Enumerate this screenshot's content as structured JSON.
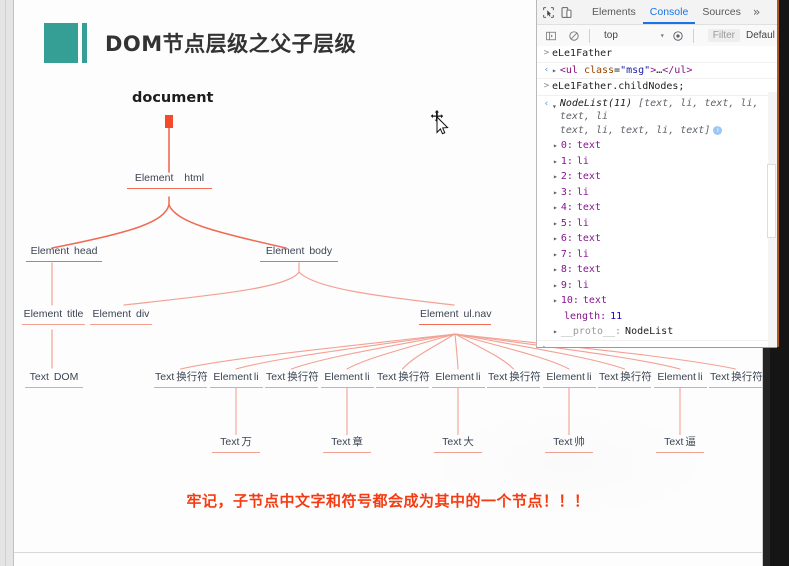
{
  "slide": {
    "title": "DOM节点层级之父子层级",
    "root_label": "document",
    "warning": "牢记，子节点中文字和符号都会成为其中的一个节点！！！",
    "accent_color": "#359e95",
    "line_color": "#f06a54",
    "warning_color": "#f63b12",
    "nodes": [
      {
        "id": "html",
        "kind": "Element",
        "name": "html"
      },
      {
        "id": "head",
        "kind": "Element",
        "name": "head"
      },
      {
        "id": "body",
        "kind": "Element",
        "name": "body"
      },
      {
        "id": "title",
        "kind": "Element",
        "name": "title"
      },
      {
        "id": "div",
        "kind": "Element",
        "name": "div"
      },
      {
        "id": "ulnav",
        "kind": "Element",
        "name": "ul.nav"
      },
      {
        "id": "dom",
        "kind": "Text",
        "name": "DOM"
      }
    ],
    "leaf_nodes": [
      {
        "kind": "Text",
        "name": "换行符"
      },
      {
        "kind": "Element",
        "name": "li"
      },
      {
        "kind": "Text",
        "name": "换行符"
      },
      {
        "kind": "Element",
        "name": "li"
      },
      {
        "kind": "Text",
        "name": "换行符"
      },
      {
        "kind": "Element",
        "name": "li"
      },
      {
        "kind": "Text",
        "name": "换行符"
      },
      {
        "kind": "Element",
        "name": "li"
      },
      {
        "kind": "Text",
        "name": "换行符"
      },
      {
        "kind": "Element",
        "name": "li"
      },
      {
        "kind": "Text",
        "name": "换行符"
      }
    ],
    "text_children": [
      {
        "kind": "Text",
        "name": "万"
      },
      {
        "kind": "Text",
        "name": "章"
      },
      {
        "kind": "Text",
        "name": "大"
      },
      {
        "kind": "Text",
        "name": "帅"
      },
      {
        "kind": "Text",
        "name": "逼"
      }
    ]
  },
  "devtools": {
    "tabs": [
      {
        "label": "Elements",
        "active": false
      },
      {
        "label": "Console",
        "active": true
      },
      {
        "label": "Sources",
        "active": false
      }
    ],
    "more_tabs": "»",
    "kebab": "⋮",
    "inspect_icon": "inspect-element-icon",
    "device_icon": "device-toolbar-icon",
    "filterbar": {
      "sidebar_icon": "console-sidebar-icon",
      "clear_icon": "clear-console-icon",
      "context": "top",
      "caret": "▾",
      "eye_icon": "live-expression-icon",
      "filter_placeholder": "Filter",
      "levels": "Defaul"
    },
    "console": [
      {
        "type": "input",
        "marker": ">",
        "text": "eLe1Father"
      },
      {
        "type": "output",
        "marker": "‹",
        "html_tag": "ul",
        "attr_name": "class",
        "attr_value": "\"msg\"",
        "ellipsis": "…"
      },
      {
        "type": "input",
        "marker": ">",
        "text": "eLe1Father.childNodes;"
      },
      {
        "type": "output",
        "marker": "‹",
        "nodelist_head": "NodeList(11)",
        "nodelist_preview_1": " [text, li, text, li, text, li",
        "nodelist_preview_2": "text, li, text, li, text]"
      }
    ],
    "nodelist_items": [
      {
        "index": "0",
        "value": "text"
      },
      {
        "index": "1",
        "value": "li"
      },
      {
        "index": "2",
        "value": "text"
      },
      {
        "index": "3",
        "value": "li"
      },
      {
        "index": "4",
        "value": "text"
      },
      {
        "index": "5",
        "value": "li"
      },
      {
        "index": "6",
        "value": "text"
      },
      {
        "index": "7",
        "value": "li"
      },
      {
        "index": "8",
        "value": "text"
      },
      {
        "index": "9",
        "value": "li"
      },
      {
        "index": "10",
        "value": "text"
      }
    ],
    "length_key": "length:",
    "length_value": "11",
    "proto_key": "__proto__:",
    "proto_value": "NodeList",
    "prompt": "›"
  },
  "cursor": {
    "name": "move-cursor"
  }
}
